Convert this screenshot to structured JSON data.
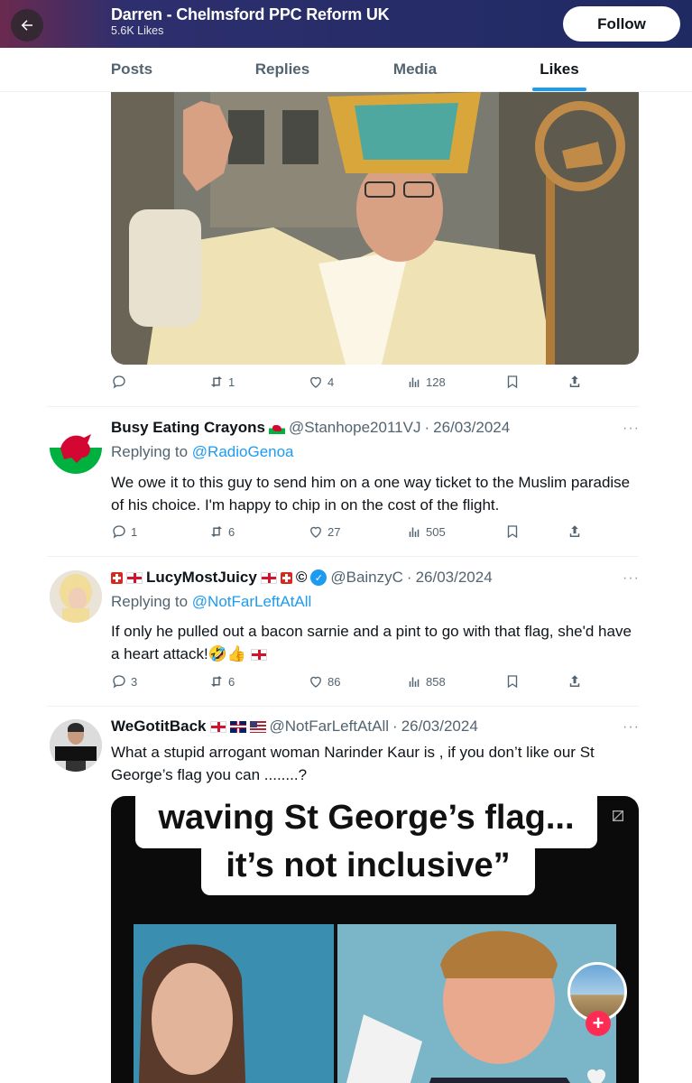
{
  "header": {
    "title": "Darren - Chelmsford PPC Reform UK",
    "subtitle": "5.6K Likes",
    "follow_label": "Follow"
  },
  "tabs": [
    {
      "label": "Posts",
      "active": false
    },
    {
      "label": "Replies",
      "active": false
    },
    {
      "label": "Media",
      "active": false
    },
    {
      "label": "Likes",
      "active": true
    }
  ],
  "first_post": {
    "actions": {
      "replies": "",
      "reposts": "1",
      "likes": "4",
      "views": "128"
    }
  },
  "tweets": [
    {
      "name": "Busy Eating Crayons",
      "name_flags": [
        "wales"
      ],
      "handle": "@Stanhope2011VJ",
      "date": "26/03/2024",
      "replying_prefix": "Replying to",
      "replying_to": "@RadioGenoa",
      "text": "We owe it to this guy to send him on a one way ticket to the Muslim paradise of his choice. I'm happy to chip in on the cost of the flight.",
      "actions": {
        "replies": "1",
        "reposts": "6",
        "likes": "27",
        "views": "505"
      }
    },
    {
      "name": "LucyMostJuicy",
      "name_prefix_flags": [
        "switzerland",
        "england"
      ],
      "name_suffix": "©",
      "name_suffix_flags": [
        "england",
        "switzerland"
      ],
      "verified": true,
      "handle": "@BainzyC",
      "date": "26/03/2024",
      "replying_prefix": "Replying to",
      "replying_to": "@NotFarLeftAtAll",
      "text": "If only he pulled out a bacon sarnie and a pint to go with that flag, she'd have a heart attack!🤣👍",
      "text_flag": "england",
      "actions": {
        "replies": "3",
        "reposts": "6",
        "likes": "86",
        "views": "858"
      }
    },
    {
      "name": "WeGotitBack",
      "name_flags": [
        "england",
        "uk",
        "us"
      ],
      "handle": "@NotFarLeftAtAll",
      "date": "26/03/2024",
      "text": "What a stupid arrogant woman Narinder Kaur is , if you don’t like our St George’s flag you can ........?"
    }
  ],
  "media2": {
    "caption_line1": "waving St George’s flag...",
    "caption_line2": "it’s not inclusive”"
  },
  "colors": {
    "accent": "#1d9bf0",
    "muted": "#536471",
    "text": "#0f1419",
    "header_bg": "#1f2a63"
  }
}
